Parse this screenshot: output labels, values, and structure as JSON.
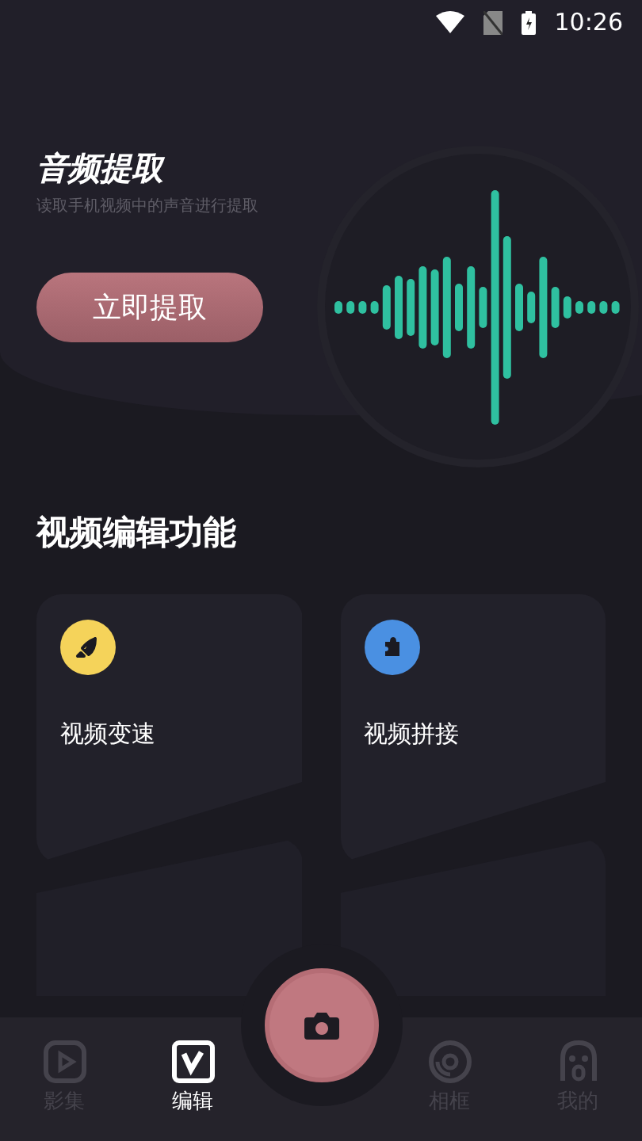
{
  "status_bar": {
    "time": "10:26"
  },
  "hero": {
    "title": "音频提取",
    "subtitle": "读取手机视频中的声音进行提取",
    "button": "立即提取"
  },
  "section": {
    "title": "视频编辑功能"
  },
  "cards": [
    {
      "label": "视频变速",
      "color": "#f5d35a",
      "kind": "rocket"
    },
    {
      "label": "视频拼接",
      "color": "#4a90e2",
      "kind": "puzzle"
    }
  ],
  "tabs": [
    {
      "label": "影集",
      "kind": "play",
      "selected": false
    },
    {
      "label": "编辑",
      "kind": "edit",
      "selected": true
    },
    {
      "label": "相框",
      "kind": "disc",
      "selected": false
    },
    {
      "label": "我的",
      "kind": "face",
      "selected": false
    }
  ]
}
